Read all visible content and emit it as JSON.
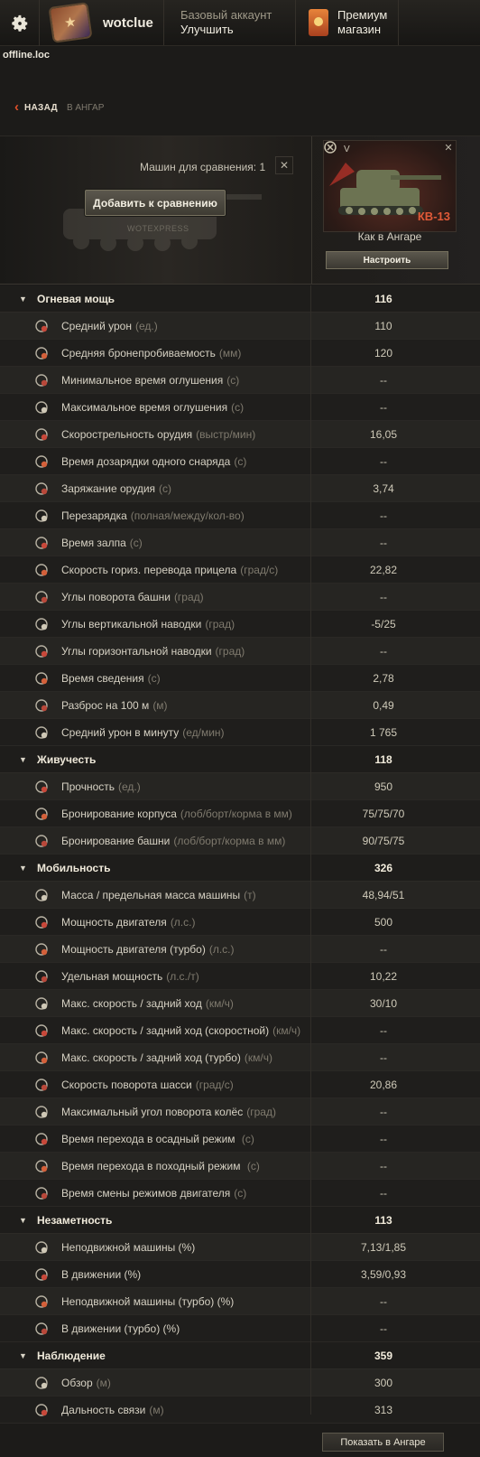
{
  "header": {
    "username": "wotclue",
    "account_type": "Базовый аккаунт",
    "upgrade_label": "Улучшить",
    "premium_line1": "Премиум",
    "premium_line2": "магазин",
    "domain": "offline.loc"
  },
  "breadcrumb": {
    "back_label": "НАЗАД",
    "target": "В АНГАР"
  },
  "compare": {
    "label": "Машин для сравнения: 1",
    "add_button": "Добавить к сравнению",
    "watermark": "WOTEXPRESS"
  },
  "vehicle": {
    "tier": "V",
    "name": "КВ-13",
    "state": "Как в Ангаре",
    "setup_button": "Настроить"
  },
  "colors": {
    "accent": "#e05a38",
    "background": "#1c1b19"
  },
  "categories": [
    {
      "title": "Огневая мощь",
      "value": "116",
      "rows": [
        {
          "icon": "damage-icon",
          "label": "Средний урон",
          "unit": "(ед.)",
          "value": "110"
        },
        {
          "icon": "penetration-icon",
          "label": "Средняя бронепробиваемость",
          "unit": "(мм)",
          "value": "120"
        },
        {
          "icon": "stun-min-icon",
          "label": "Минимальное время оглушения",
          "unit": "(с)",
          "value": "--"
        },
        {
          "icon": "stun-max-icon",
          "label": "Максимальное время оглушения",
          "unit": "(с)",
          "value": "--"
        },
        {
          "icon": "rate-of-fire-icon",
          "label": "Скорострельность орудия",
          "unit": "(выстр/мин)",
          "value": "16,05"
        },
        {
          "icon": "shell-reload-icon",
          "label": "Время дозарядки одного снаряда",
          "unit": "(с)",
          "value": "--"
        },
        {
          "icon": "reload-icon",
          "label": "Заряжание орудия",
          "unit": "(с)",
          "value": "3,74"
        },
        {
          "icon": "clip-reload-icon",
          "label": "Перезарядка",
          "unit": "(полная/между/кол-во)",
          "value": "--"
        },
        {
          "icon": "salvo-icon",
          "label": "Время залпа",
          "unit": "(с)",
          "value": "--"
        },
        {
          "icon": "traverse-icon",
          "label": "Скорость гориз. перевода прицела",
          "unit": "(град/с)",
          "value": "22,82"
        },
        {
          "icon": "turret-angle-icon",
          "label": "Углы поворота башни",
          "unit": "(град)",
          "value": "--"
        },
        {
          "icon": "elevation-icon",
          "label": "Углы вертикальной наводки",
          "unit": "(град)",
          "value": "-5/25"
        },
        {
          "icon": "horizontal-aim-icon",
          "label": "Углы горизонтальной наводки",
          "unit": "(град)",
          "value": "--"
        },
        {
          "icon": "aim-time-icon",
          "label": "Время сведения",
          "unit": "(с)",
          "value": "2,78"
        },
        {
          "icon": "dispersion-icon",
          "label": "Разброс на 100 м",
          "unit": "(м)",
          "value": "0,49"
        },
        {
          "icon": "dpm-icon",
          "label": "Средний урон в минуту",
          "unit": "(ед/мин)",
          "value": "1 765"
        }
      ]
    },
    {
      "title": "Живучесть",
      "value": "118",
      "rows": [
        {
          "icon": "hit-points-icon",
          "label": "Прочность",
          "unit": "(ед.)",
          "value": "950"
        },
        {
          "icon": "hull-armor-icon",
          "label": "Бронирование корпуса",
          "unit": "(лоб/борт/корма в мм)",
          "value": "75/75/70"
        },
        {
          "icon": "turret-armor-icon",
          "label": "Бронирование башни",
          "unit": "(лоб/борт/корма в мм)",
          "value": "90/75/75"
        }
      ]
    },
    {
      "title": "Мобильность",
      "value": "326",
      "rows": [
        {
          "icon": "weight-icon",
          "label": "Масса / предельная масса машины",
          "unit": "(т)",
          "value": "48,94/51"
        },
        {
          "icon": "engine-icon",
          "label": "Мощность двигателя",
          "unit": "(л.с.)",
          "value": "500"
        },
        {
          "icon": "engine-turbo-icon",
          "label": "Мощность двигателя (турбо)",
          "unit": "(л.с.)",
          "value": "--"
        },
        {
          "icon": "specific-power-icon",
          "label": "Удельная мощность",
          "unit": "(л.с./т)",
          "value": "10,22"
        },
        {
          "icon": "speed-icon",
          "label": "Макс. скорость / задний ход",
          "unit": "(км/ч)",
          "value": "30/10"
        },
        {
          "icon": "speed-fast-icon",
          "label": "Макс. скорость / задний ход (скоростной)",
          "unit": "(км/ч)",
          "value": "--"
        },
        {
          "icon": "speed-turbo-icon",
          "label": "Макс. скорость / задний ход (турбо)",
          "unit": "(км/ч)",
          "value": "--"
        },
        {
          "icon": "hull-traverse-icon",
          "label": "Скорость поворота шасси",
          "unit": "(град/с)",
          "value": "20,86"
        },
        {
          "icon": "wheel-angle-icon",
          "label": "Максимальный угол поворота колёс",
          "unit": "(град)",
          "value": "--"
        },
        {
          "icon": "siege-mode-icon",
          "label": "Время перехода в осадный режим ",
          "unit": "(с)",
          "value": "--"
        },
        {
          "icon": "travel-mode-icon",
          "label": "Время перехода в походный режим ",
          "unit": "(с)",
          "value": "--"
        },
        {
          "icon": "engine-mode-icon",
          "label": "Время смены режимов двигателя",
          "unit": "(с)",
          "value": "--"
        }
      ]
    },
    {
      "title": "Незаметность",
      "value": "113",
      "rows": [
        {
          "icon": "camo-still-icon",
          "label": "Неподвижной машины (%)",
          "unit": "",
          "value": "7,13/1,85"
        },
        {
          "icon": "camo-moving-icon",
          "label": "В движении (%)",
          "unit": "",
          "value": "3,59/0,93"
        },
        {
          "icon": "camo-still-turbo-icon",
          "label": "Неподвижной машины (турбо) (%)",
          "unit": "",
          "value": "--"
        },
        {
          "icon": "camo-moving-turbo-icon",
          "label": "В движении (турбо) (%)",
          "unit": "",
          "value": "--"
        }
      ]
    },
    {
      "title": "Наблюдение",
      "value": "359",
      "rows": [
        {
          "icon": "view-range-icon",
          "label": "Обзор",
          "unit": "(м)",
          "value": "300"
        },
        {
          "icon": "radio-range-icon",
          "label": "Дальность связи",
          "unit": "(м)",
          "value": "313"
        }
      ]
    }
  ],
  "footer": {
    "show_in_hangar": "Показать в Ангаре"
  }
}
